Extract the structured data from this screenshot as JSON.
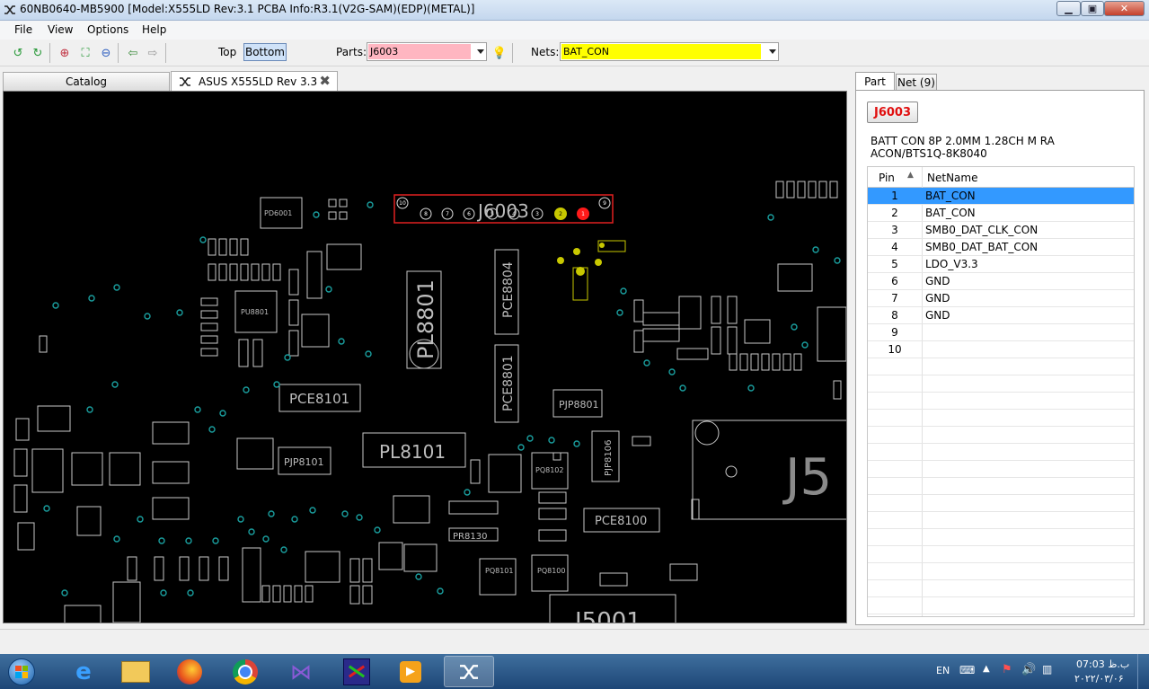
{
  "window": {
    "title": "60NB0640-MB5900 [Model:X555LD Rev:3.1 PCBA Info:R3.1(V2G-SAM)(EDP)(METAL)]",
    "minimize": "▁",
    "maximize": "▣",
    "close": "✕"
  },
  "menu": [
    "File",
    "View",
    "Options",
    "Help"
  ],
  "toolbar": {
    "top_label": "Top",
    "bottom_label": "Bottom",
    "parts_label": "Parts:",
    "parts_value": "J6003",
    "nets_label": "Nets:",
    "nets_value": "BAT_CON",
    "colors": {
      "parts_bg": "#ffb6c1",
      "nets_bg": "#ffff00"
    }
  },
  "tabs": {
    "catalog": "Catalog",
    "board": "ASUS X555LD Rev 3.3"
  },
  "board": {
    "highlight_part": "J6003",
    "labels": [
      "PL8801",
      "PCE8804",
      "PCE8801",
      "PCE8101",
      "PL8101",
      "PJP8101",
      "PJP8801",
      "PJP8106",
      "PCE8100",
      "J5",
      "J5001",
      "PD6001",
      "PR8130",
      "PQ8101",
      "PQ8100",
      "PQ8102",
      "PU8801"
    ],
    "pin_numbers": [
      "10",
      "8",
      "7",
      "6",
      "5",
      "4",
      "3",
      "2",
      "1",
      "9"
    ],
    "colors": {
      "outline": "#c8c8c8",
      "net_pin": "#c8c800",
      "pin1": "#ff1a1a",
      "via": "#1a9e9e",
      "highlight_box": "#e02020"
    }
  },
  "right_panel": {
    "tabs": [
      "Part",
      "Net (9)"
    ],
    "part_name": "J6003",
    "description_line1": "BATT CON 8P 2.0MM 1.28CH M RA",
    "description_line2": "ACON/BTS1Q-8K8040",
    "columns": {
      "pin": "Pin",
      "net": "NetName"
    },
    "rows": [
      {
        "pin": "1",
        "net": "BAT_CON"
      },
      {
        "pin": "2",
        "net": "BAT_CON"
      },
      {
        "pin": "3",
        "net": "SMB0_DAT_CLK_CON"
      },
      {
        "pin": "4",
        "net": "SMB0_DAT_BAT_CON"
      },
      {
        "pin": "5",
        "net": "LDO_V3.3"
      },
      {
        "pin": "6",
        "net": "GND"
      },
      {
        "pin": "7",
        "net": "GND"
      },
      {
        "pin": "8",
        "net": "GND"
      },
      {
        "pin": "9",
        "net": ""
      },
      {
        "pin": "10",
        "net": ""
      }
    ],
    "selected_row_color": "#3399ff"
  },
  "taskbar": {
    "lang": "EN",
    "time": "07:03 ب.ظ",
    "date": "۲۰۲۲/۰۳/۰۶"
  }
}
